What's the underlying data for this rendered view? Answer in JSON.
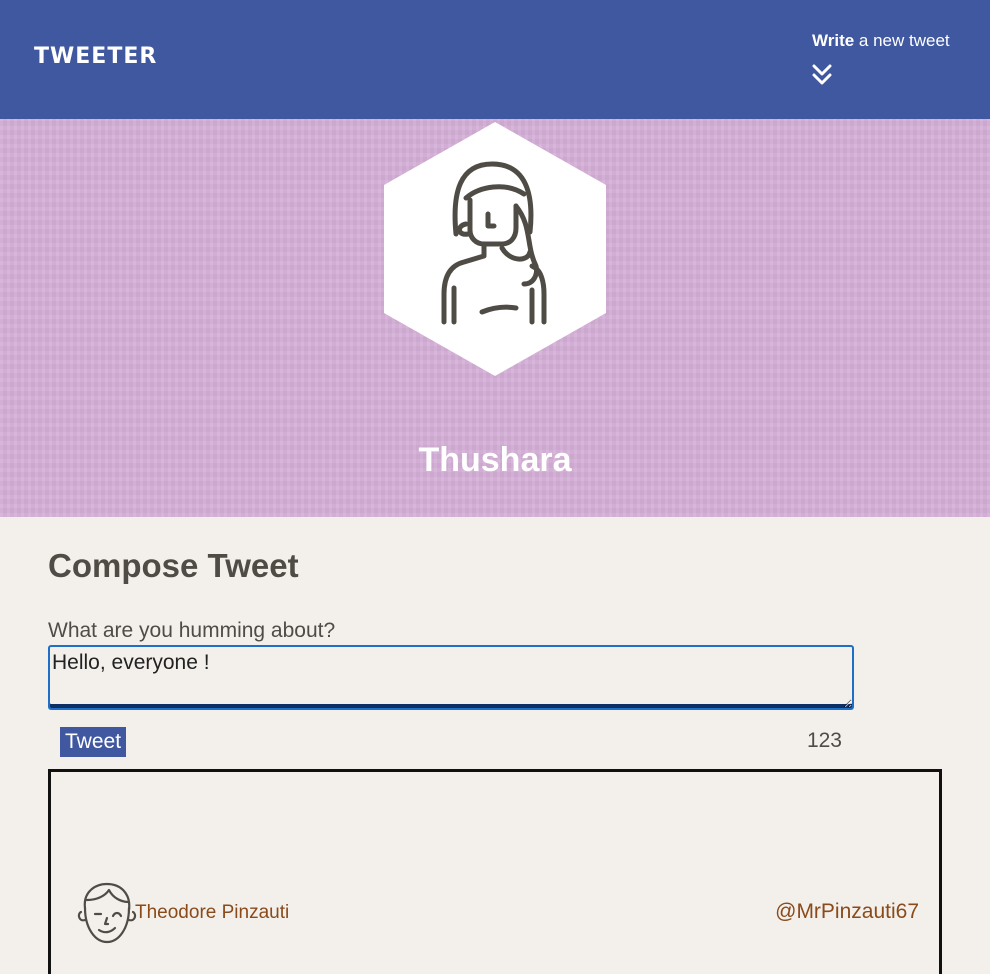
{
  "navbar": {
    "logo": "TWEETER",
    "compose_toggle": {
      "bold": "Write",
      "rest": " a new tweet",
      "icon": "double-chevron-down-icon"
    }
  },
  "profile": {
    "name": "Thushara",
    "avatar_icon": "woman-avatar-icon",
    "banner_color": "#d4aed6"
  },
  "composer": {
    "title": "Compose Tweet",
    "label": "What are you humming about?",
    "input_value": "Hello, everyone !",
    "submit_label": "Tweet",
    "counter": "123"
  },
  "tweets": [
    {
      "author": "Theodore Pinzauti",
      "handle": "@MrPinzauti67",
      "avatar_icon": "man-avatar-icon"
    }
  ],
  "colors": {
    "nav": "#4058a0",
    "accent": "#4058a0",
    "link": "#8a4a1a",
    "background": "#f3f0ec"
  }
}
